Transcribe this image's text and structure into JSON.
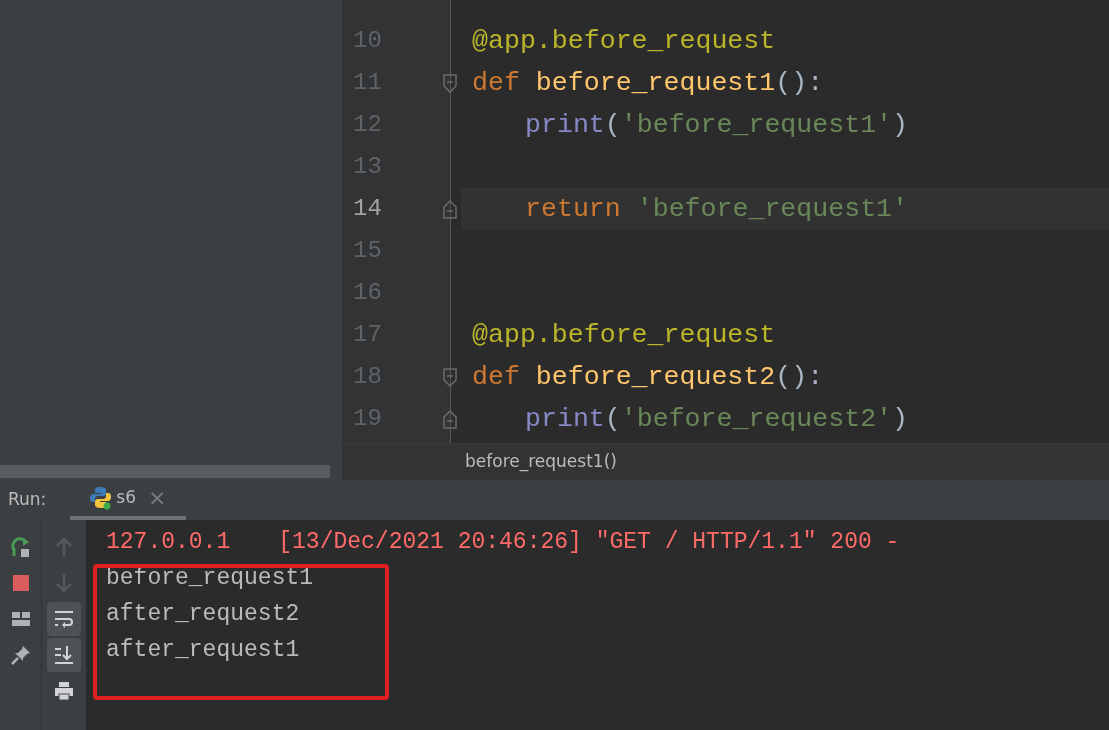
{
  "editor": {
    "lines": [
      {
        "number": "10",
        "current": false,
        "fold_start": false,
        "fold_end": false,
        "indent": false,
        "tokens": [
          {
            "kind": "decorator",
            "text": "@app.before_request"
          }
        ]
      },
      {
        "number": "11",
        "current": false,
        "fold_start": true,
        "fold_end": false,
        "indent": false,
        "tokens": [
          {
            "kind": "keyword",
            "text": "def "
          },
          {
            "kind": "function",
            "text": "before_request1"
          },
          {
            "kind": "paren",
            "text": "():"
          }
        ]
      },
      {
        "number": "12",
        "current": false,
        "fold_start": false,
        "fold_end": false,
        "indent": true,
        "tokens": [
          {
            "kind": "builtin",
            "text": "print"
          },
          {
            "kind": "paren",
            "text": "("
          },
          {
            "kind": "string",
            "text": "'before_request1'"
          },
          {
            "kind": "paren",
            "text": ")"
          }
        ]
      },
      {
        "number": "13",
        "current": false,
        "fold_start": false,
        "fold_end": false
      },
      {
        "number": "14",
        "current": true,
        "fold_start": false,
        "fold_end": true,
        "indent": true,
        "tokens": [
          {
            "kind": "keyword",
            "text": "return "
          },
          {
            "kind": "string",
            "text": "'before_request1'"
          }
        ]
      },
      {
        "number": "15",
        "current": false,
        "fold_start": false,
        "fold_end": false
      },
      {
        "number": "16",
        "current": false,
        "fold_start": false,
        "fold_end": false
      },
      {
        "number": "17",
        "current": false,
        "fold_start": false,
        "fold_end": false,
        "indent": false,
        "tokens": [
          {
            "kind": "decorator",
            "text": "@app.before_request"
          }
        ]
      },
      {
        "number": "18",
        "current": false,
        "fold_start": true,
        "fold_end": false,
        "indent": false,
        "tokens": [
          {
            "kind": "keyword",
            "text": "def "
          },
          {
            "kind": "function",
            "text": "before_request2"
          },
          {
            "kind": "paren",
            "text": "():"
          }
        ]
      },
      {
        "number": "19",
        "current": false,
        "fold_start": false,
        "fold_end": true,
        "indent": true,
        "tokens": [
          {
            "kind": "builtin",
            "text": "print"
          },
          {
            "kind": "paren",
            "text": "("
          },
          {
            "kind": "string",
            "text": "'before_request2'"
          },
          {
            "kind": "paren",
            "text": ")"
          }
        ]
      }
    ],
    "breadcrumb": "before_request1()"
  },
  "run": {
    "label": "Run:",
    "tabs": [
      {
        "label": "s6",
        "selected": true,
        "close": "×"
      }
    ]
  },
  "run_toolbar": [
    {
      "kind": "rerun"
    },
    {
      "kind": "stop"
    },
    {
      "kind": "layout"
    },
    {
      "kind": "pin"
    }
  ],
  "console_toolbar": [
    {
      "kind": "up",
      "disabled": true,
      "on": false
    },
    {
      "kind": "down",
      "disabled": true,
      "on": false
    },
    {
      "kind": "wrap",
      "disabled": false,
      "on": true
    },
    {
      "kind": "scroll-end",
      "disabled": false,
      "on": true
    },
    {
      "kind": "print",
      "disabled": false,
      "on": false
    }
  ],
  "console": [
    {
      "kind": "stderr",
      "parts": [
        "127.0.0.1",
        "[13/Dec/2021 20:46:26] \"GET / HTTP/1.1\" 200 -"
      ]
    },
    {
      "kind": "stdout",
      "parts": [
        "before_request1"
      ]
    },
    {
      "kind": "stdout",
      "parts": [
        "after_request2"
      ]
    },
    {
      "kind": "stdout",
      "parts": [
        "after_request1"
      ]
    }
  ]
}
